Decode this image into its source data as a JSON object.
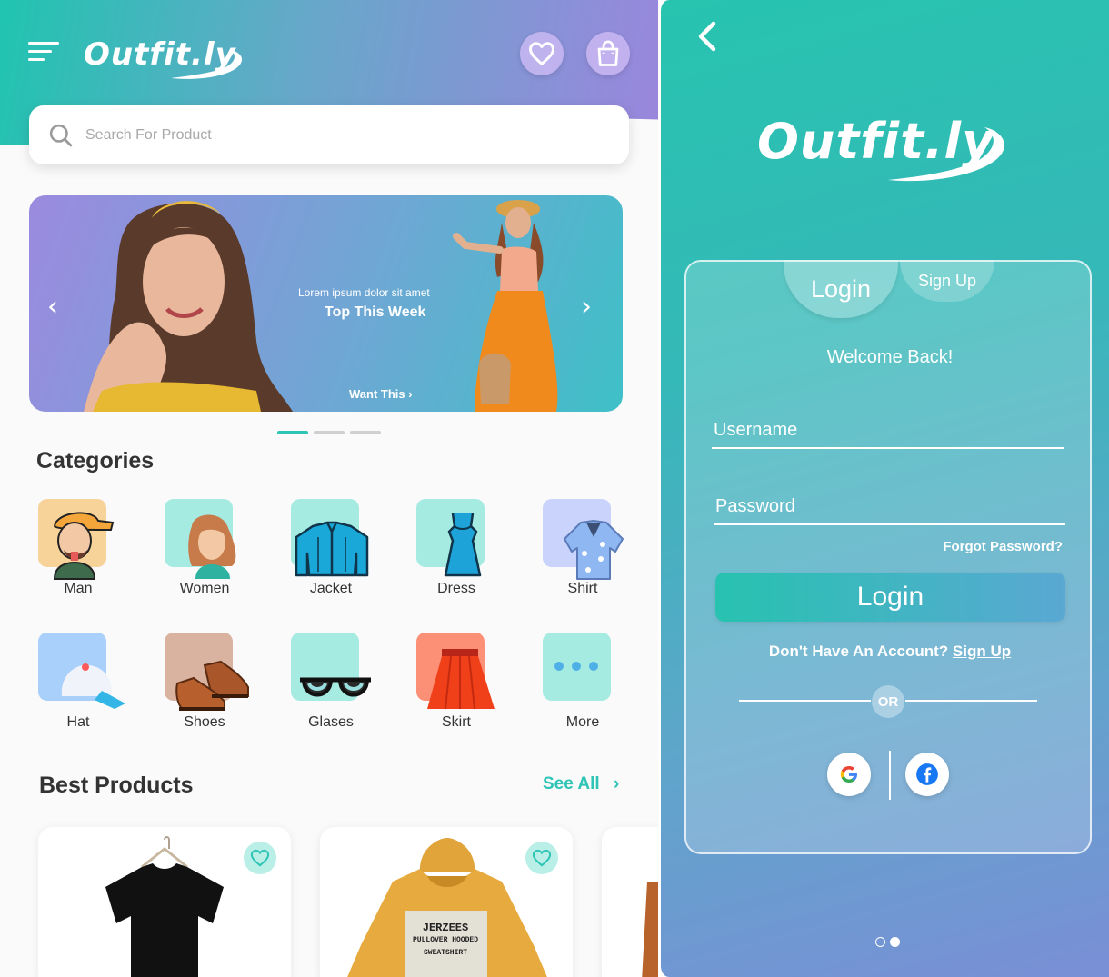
{
  "home": {
    "logo": "Outfit.ly",
    "search": {
      "placeholder": "Search For Product"
    },
    "banner": {
      "subtitle": "Lorem ipsum dolor sit amet",
      "title": "Top This Week",
      "cta": "Want This ›"
    },
    "carousel": {
      "total": 3,
      "active": 1
    },
    "categories_title": "Categories",
    "categories": [
      {
        "label": "Man",
        "icon": "man-avatar-icon",
        "color": "#f7d39a"
      },
      {
        "label": "Women",
        "icon": "woman-avatar-icon",
        "color": "#a6ebe1"
      },
      {
        "label": "Jacket",
        "icon": "jacket-icon",
        "color": "#a6ebe1"
      },
      {
        "label": "Dress",
        "icon": "dress-icon",
        "color": "#a6ebe1"
      },
      {
        "label": "Shirt",
        "icon": "shirt-icon",
        "color": "#c9d3fb"
      },
      {
        "label": "Hat",
        "icon": "cap-icon",
        "color": "#a8d0fb"
      },
      {
        "label": "Shoes",
        "icon": "shoes-icon",
        "color": "#d9b3a0"
      },
      {
        "label": "Glases",
        "icon": "glasses-icon",
        "color": "#a6ebe1"
      },
      {
        "label": "Skirt",
        "icon": "skirt-icon",
        "color": "#fc9077"
      },
      {
        "label": "More",
        "icon": "more-dots-icon",
        "color": "#a6ebe1"
      }
    ],
    "best_products_title": "Best Products",
    "see_all": "See All",
    "products": [
      {
        "name": "black-tshirt"
      },
      {
        "name": "hoodie",
        "print": [
          "JERZEES",
          "PULLOVER HOODED",
          "SWEATSHIRT"
        ]
      }
    ]
  },
  "login": {
    "logo": "Outfit.ly",
    "tabs": {
      "login": "Login",
      "signup": "Sign Up"
    },
    "welcome": "Welcome Back!",
    "username_placeholder": "Username",
    "password_placeholder": "Password",
    "forgot": "Forgot Password?",
    "submit": "Login",
    "no_account": "Don't Have An Account?",
    "signup_link": "Sign Up",
    "or": "OR",
    "pager": {
      "total": 2,
      "active": 2
    }
  },
  "colors": {
    "accent": "#2ec4b6",
    "header_gradient": [
      "#20c4b0",
      "#9a86dd"
    ]
  }
}
